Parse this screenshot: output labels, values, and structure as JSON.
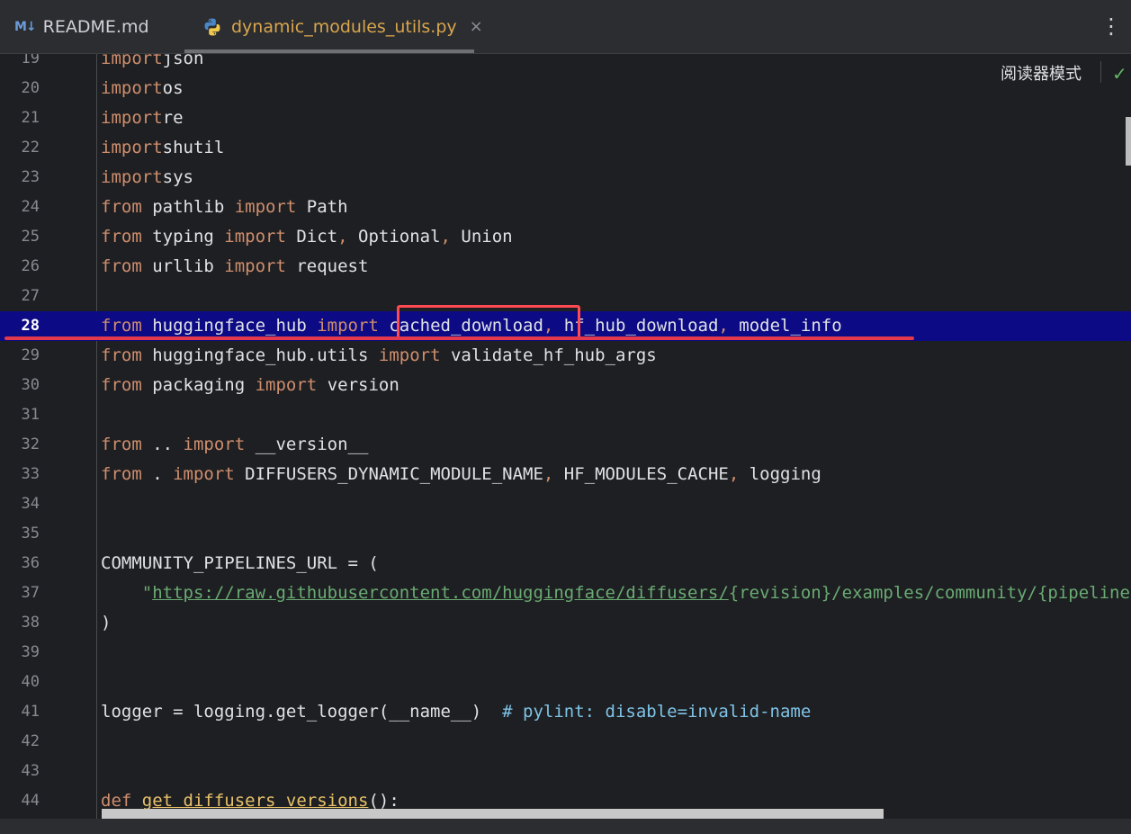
{
  "tabs": [
    {
      "icon": "markdown-icon",
      "icon_text": "M↓",
      "label": "README.md"
    },
    {
      "icon": "python-icon",
      "label": "dynamic_modules_utils.py",
      "active": true
    }
  ],
  "tab_close_glyph": "×",
  "more_menu_glyph": "⋮",
  "reader_mode_label": "阅读器模式",
  "check_glyph": "✓",
  "colors": {
    "keyword": "#cf8e6d",
    "string": "#6aab73",
    "comment": "#7ec3e6",
    "function": "#e8c26b",
    "current_line_bg": "#0c0a84",
    "annotation": "#ff4a52"
  },
  "current_line": 28,
  "lines": [
    {
      "n": "19",
      "t": [
        [
          "kw",
          "import"
        ],
        [
          "",
          "json"
        ]
      ]
    },
    {
      "n": "20",
      "t": [
        [
          "kw",
          "import"
        ],
        [
          "",
          "os"
        ]
      ]
    },
    {
      "n": "21",
      "t": [
        [
          "kw",
          "import"
        ],
        [
          "",
          "re"
        ]
      ]
    },
    {
      "n": "22",
      "t": [
        [
          "kw",
          "import"
        ],
        [
          "",
          "shutil"
        ]
      ]
    },
    {
      "n": "23",
      "t": [
        [
          "kw",
          "import"
        ],
        [
          "",
          "sys"
        ]
      ]
    },
    {
      "n": "24",
      "t": [
        [
          "kw",
          "from"
        ],
        [
          "",
          " pathlib "
        ],
        [
          "kw",
          "import"
        ],
        [
          "",
          " Path"
        ]
      ]
    },
    {
      "n": "25",
      "t": [
        [
          "kw",
          "from"
        ],
        [
          "",
          " typing "
        ],
        [
          "kw",
          "import"
        ],
        [
          "",
          " Dict"
        ],
        [
          "comma",
          ","
        ],
        [
          "",
          " Optional"
        ],
        [
          "comma",
          ","
        ],
        [
          "",
          " Union"
        ]
      ]
    },
    {
      "n": "26",
      "t": [
        [
          "kw",
          "from"
        ],
        [
          "",
          " urllib "
        ],
        [
          "kw",
          "import"
        ],
        [
          "",
          " request"
        ]
      ]
    },
    {
      "n": "27",
      "t": []
    },
    {
      "n": "28",
      "t": [
        [
          "kw",
          "from"
        ],
        [
          "",
          " huggingface_hub "
        ],
        [
          "kw",
          "import"
        ],
        [
          "",
          " cached_download"
        ],
        [
          "comma",
          ","
        ],
        [
          "",
          " hf_hub_download"
        ],
        [
          "comma",
          ","
        ],
        [
          "",
          " model_info"
        ]
      ]
    },
    {
      "n": "29",
      "t": [
        [
          "kw",
          "from"
        ],
        [
          "",
          " huggingface_hub.utils "
        ],
        [
          "kw",
          "import"
        ],
        [
          "",
          " validate_hf_hub_args"
        ]
      ]
    },
    {
      "n": "30",
      "t": [
        [
          "kw",
          "from"
        ],
        [
          "",
          " packaging "
        ],
        [
          "kw",
          "import"
        ],
        [
          "",
          " version"
        ]
      ]
    },
    {
      "n": "31",
      "t": []
    },
    {
      "n": "32",
      "t": [
        [
          "kw",
          "from"
        ],
        [
          "",
          " .. "
        ],
        [
          "kw",
          "import"
        ],
        [
          "",
          " __version__"
        ]
      ]
    },
    {
      "n": "33",
      "t": [
        [
          "kw",
          "from"
        ],
        [
          "",
          " . "
        ],
        [
          "kw",
          "import"
        ],
        [
          "",
          " DIFFUSERS_DYNAMIC_MODULE_NAME"
        ],
        [
          "comma",
          ","
        ],
        [
          "",
          " HF_MODULES_CACHE"
        ],
        [
          "comma",
          ","
        ],
        [
          "",
          " logging"
        ]
      ]
    },
    {
      "n": "34",
      "t": []
    },
    {
      "n": "35",
      "t": []
    },
    {
      "n": "36",
      "t": [
        [
          "",
          "COMMUNITY_PIPELINES_URL = ("
        ]
      ]
    },
    {
      "n": "37",
      "t": [
        [
          "str",
          "    \""
        ],
        [
          "url",
          "https://raw.githubusercontent.com/huggingface/diffusers/"
        ],
        [
          "strcurly",
          "{revision}/examples/community/{pipeline}.py\""
        ]
      ]
    },
    {
      "n": "38",
      "t": [
        [
          "",
          ")"
        ]
      ]
    },
    {
      "n": "39",
      "t": []
    },
    {
      "n": "40",
      "t": []
    },
    {
      "n": "41",
      "t": [
        [
          "",
          "logger = logging.get_logger(__name__)  "
        ],
        [
          "comment",
          "# pylint: disable=invalid-name"
        ]
      ]
    },
    {
      "n": "42",
      "t": []
    },
    {
      "n": "43",
      "t": []
    },
    {
      "n": "44",
      "t": [
        [
          "kw",
          "def"
        ],
        [
          "",
          " "
        ],
        [
          "fn",
          "get_diffusers_versions"
        ],
        [
          "",
          "():"
        ]
      ]
    }
  ]
}
